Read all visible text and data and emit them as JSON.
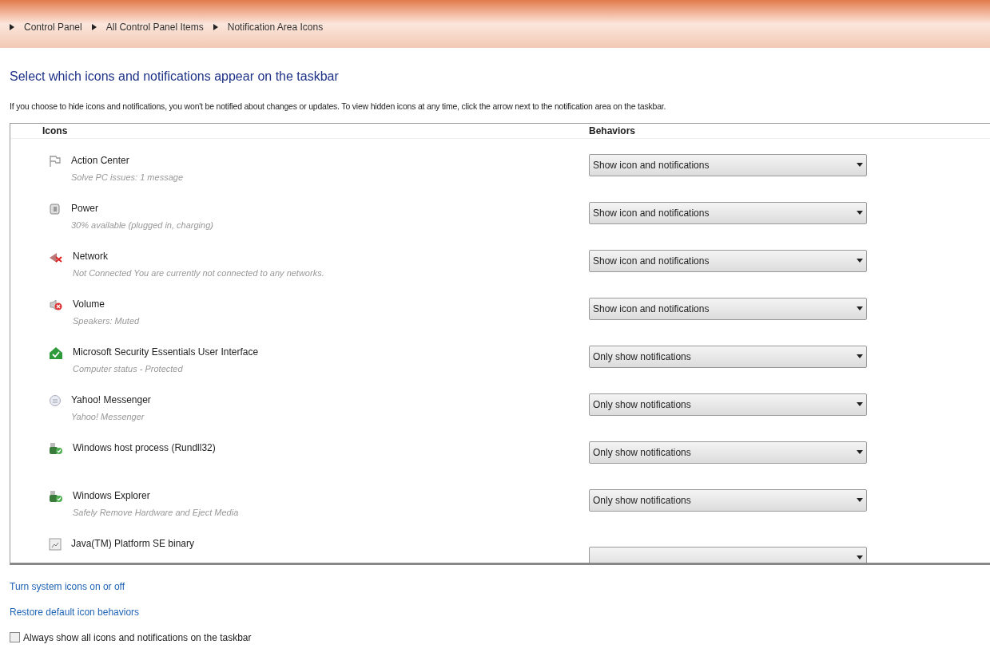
{
  "breadcrumb": [
    "Control Panel",
    "All Control Panel Items",
    "Notification Area Icons"
  ],
  "heading": "Select which icons and notifications appear on the taskbar",
  "description": "If you choose to hide icons and notifications, you won't be notified about changes or updates. To view hidden icons at any time, click the arrow next to the notification area on the taskbar.",
  "table": {
    "columns": [
      "Icons",
      "Behaviors"
    ],
    "rows": [
      {
        "kind": "flag",
        "name": "Action Center",
        "detail": "Solve PC issues: 1 message",
        "behavior": "Show icon and notifications"
      },
      {
        "kind": "power",
        "name": "Power",
        "detail": "30% available (plugged in, charging)",
        "behavior": "Show icon and notifications"
      },
      {
        "kind": "network",
        "name": "Network",
        "detail": "Not Connected You are currently not connected to any networks.",
        "behavior": "Show icon and notifications"
      },
      {
        "kind": "volume",
        "name": "Volume",
        "detail": "Speakers: Muted",
        "behavior": "Show icon and notifications"
      },
      {
        "kind": "security",
        "name": "Microsoft Security Essentials User Interface",
        "detail": "Computer status - Protected",
        "behavior": "Only show notifications"
      },
      {
        "kind": "messenger",
        "name": "Yahoo! Messenger",
        "detail": "Yahoo! Messenger",
        "behavior": "Only show notifications"
      },
      {
        "kind": "host",
        "name": "Windows host process (Rundll32)",
        "behavior": "Only show notifications"
      },
      {
        "kind": "host",
        "name": "Windows Explorer",
        "detail": "Safely Remove Hardware and Eject Media",
        "behavior": "Only show notifications"
      },
      {
        "kind": "java",
        "name": "Java(TM) Platform SE binary"
      }
    ]
  },
  "links": [
    "Turn system icons on or off",
    "Restore default icon behaviors"
  ],
  "always_show": {
    "label": "Always show all icons and notifications on the taskbar",
    "checked": false
  }
}
